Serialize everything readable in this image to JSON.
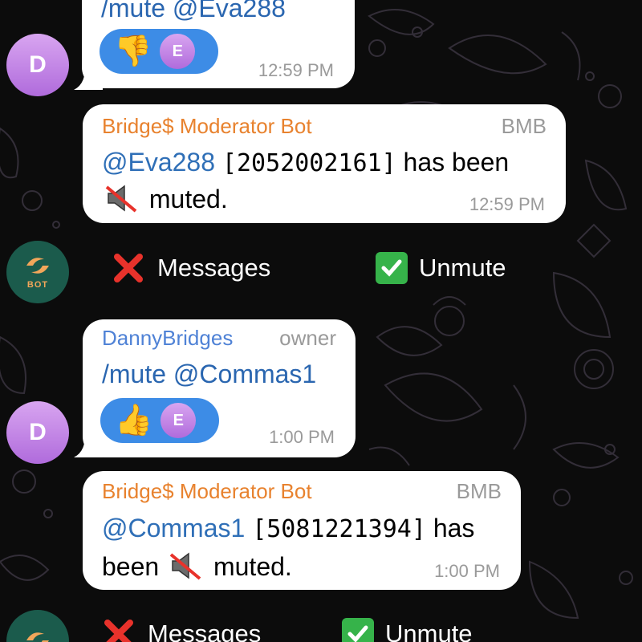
{
  "messages": [
    {
      "id": "top-command",
      "command": "/mute @Eva288",
      "reaction": {
        "emoji": "👎",
        "reactor_initial": "E"
      },
      "time": "12:59 PM",
      "avatar_initial": "D"
    },
    {
      "id": "bot-reply-1",
      "sender": "Bridge$ Moderator Bot",
      "role": "BMB",
      "mention": "@Eva288",
      "user_id": "[2052002161]",
      "text_before_icon": "has been",
      "text_after_icon": "muted.",
      "time": "12:59 PM",
      "icon": "muted-speaker-icon"
    },
    {
      "id": "owner-command",
      "sender": "DannyBridges",
      "role": "owner",
      "command": "/mute @Commas1",
      "reaction": {
        "emoji": "👍",
        "reactor_initial": "E"
      },
      "time": "1:00 PM",
      "avatar_initial": "D"
    },
    {
      "id": "bot-reply-2",
      "sender": "Bridge$ Moderator Bot",
      "role": "BMB",
      "mention": "@Commas1",
      "user_id": "[5081221394]",
      "text_line1_after_id": "has",
      "text_before_icon": "been",
      "text_after_icon": "muted.",
      "time": "1:00 PM",
      "icon": "muted-speaker-icon"
    }
  ],
  "keyboards": [
    {
      "messages_label": "Messages",
      "unmute_label": "Unmute"
    },
    {
      "messages_label": "Messages",
      "unmute_label": "Unmute"
    }
  ],
  "bot_avatar": {
    "label": "BOT"
  },
  "colors": {
    "background": "#0c0c0c",
    "bubble": "#ffffff",
    "sender_blue": "#4f82d6",
    "sender_orange": "#e8822e",
    "reaction_blue": "#3d8ce6",
    "check_green": "#36b34a",
    "cross_red": "#e8322b"
  }
}
